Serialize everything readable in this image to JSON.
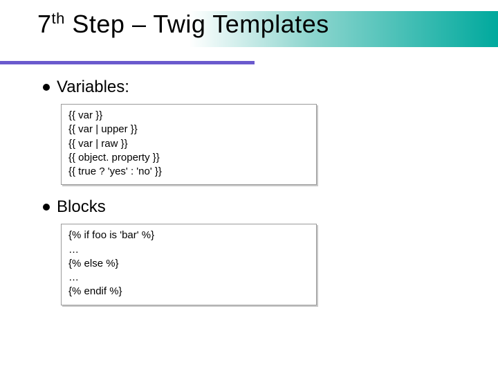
{
  "title": {
    "prefix": "7",
    "sup": "th",
    "rest": " Step – Twig Templates"
  },
  "sections": [
    {
      "heading": "Variables:",
      "code": [
        "{{ var }}",
        "{{ var | upper }}",
        "{{ var | raw }}",
        "{{ object. property }}",
        "{{ true ? 'yes' : 'no' }}"
      ]
    },
    {
      "heading": "Blocks",
      "code": [
        "{% if foo is 'bar' %}",
        "…",
        "{% else %}",
        "…",
        "{% endif %}"
      ]
    }
  ]
}
